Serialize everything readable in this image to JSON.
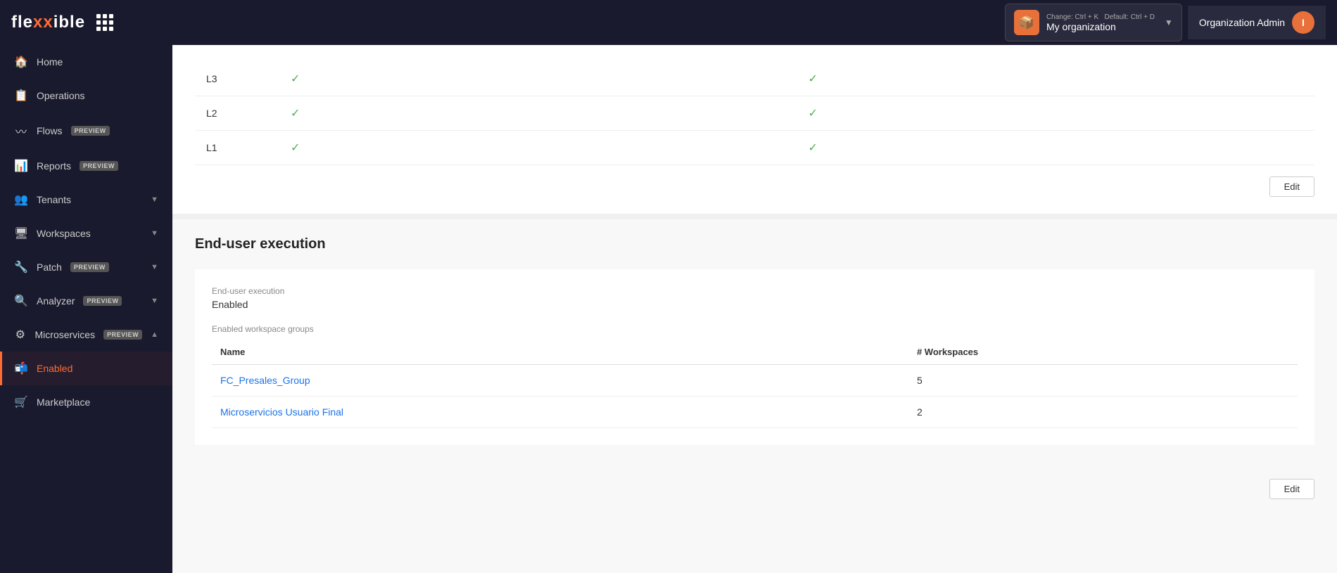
{
  "header": {
    "logo": "flexxible",
    "org": {
      "name": "My organization",
      "shortcut_change": "Change: Ctrl + K",
      "shortcut_default": "Default: Ctrl + D",
      "icon": "📦"
    },
    "admin_label": "Organization Admin",
    "admin_initial": "I"
  },
  "sidebar": {
    "items": [
      {
        "id": "home",
        "label": "Home",
        "icon": "🏠",
        "preview": false,
        "active": false,
        "chevron": false
      },
      {
        "id": "operations",
        "label": "Operations",
        "icon": "📋",
        "preview": false,
        "active": false,
        "chevron": false
      },
      {
        "id": "flows",
        "label": "Flows",
        "icon": "〰",
        "preview": true,
        "active": false,
        "chevron": false
      },
      {
        "id": "reports",
        "label": "Reports",
        "icon": "📊",
        "preview": true,
        "active": false,
        "chevron": false
      },
      {
        "id": "tenants",
        "label": "Tenants",
        "icon": "👥",
        "preview": false,
        "active": false,
        "chevron": true
      },
      {
        "id": "workspaces",
        "label": "Workspaces",
        "icon": "🖥",
        "preview": false,
        "active": false,
        "chevron": true
      },
      {
        "id": "patch",
        "label": "Patch",
        "icon": "🔧",
        "preview": true,
        "active": false,
        "chevron": true
      },
      {
        "id": "analyzer",
        "label": "Analyzer",
        "icon": "🔍",
        "preview": true,
        "active": false,
        "chevron": true
      },
      {
        "id": "microservices",
        "label": "Microservices",
        "icon": "⚙",
        "preview": true,
        "active": false,
        "chevron": true
      },
      {
        "id": "enabled",
        "label": "Enabled",
        "icon": "📬",
        "preview": false,
        "active": true,
        "chevron": false
      },
      {
        "id": "marketplace",
        "label": "Marketplace",
        "icon": "🛒",
        "preview": false,
        "active": false,
        "chevron": false
      }
    ]
  },
  "top_table": {
    "rows": [
      {
        "level": "L3",
        "col2_check": true,
        "col3_check": true
      },
      {
        "level": "L2",
        "col2_check": true,
        "col3_check": true
      },
      {
        "level": "L1",
        "col2_check": true,
        "col3_check": true
      }
    ],
    "edit_label": "Edit"
  },
  "execution_section": {
    "title": "End-user execution",
    "field_label": "End-user execution",
    "field_value": "Enabled",
    "groups_label": "Enabled workspace groups",
    "table_headers": [
      "Name",
      "# Workspaces"
    ],
    "rows": [
      {
        "name": "FC_Presales_Group",
        "workspaces": "5"
      },
      {
        "name": "Microservicios Usuario Final",
        "workspaces": "2"
      }
    ],
    "edit_label": "Edit"
  }
}
